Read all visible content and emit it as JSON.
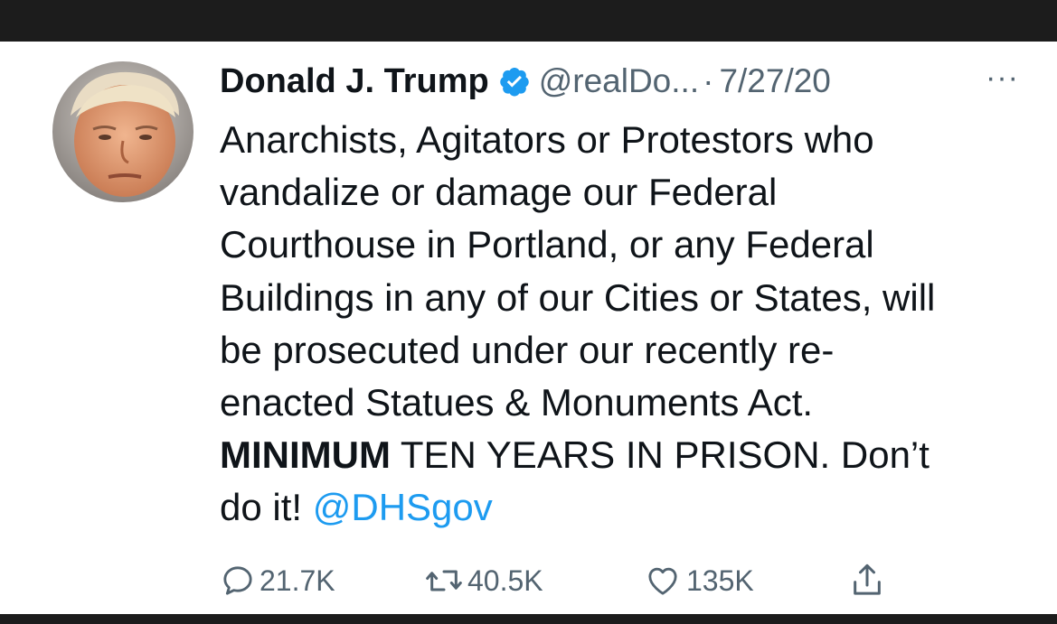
{
  "tweet": {
    "author_name": "Donald J. Trump",
    "handle": "@realDo...",
    "separator": "·",
    "date": "7/27/20",
    "more_label": "···",
    "lines": [
      {
        "normal": "Anarchists, Agitators or Protestors who"
      },
      {
        "normal": "vandalize or damage our Federal"
      },
      {
        "normal": "Courthouse in Portland, or any Federal"
      },
      {
        "normal": "Buildings in any of our Cities or States, will"
      },
      {
        "normal": "be prosecuted under our recently re-"
      },
      {
        "normal": "enacted Statues & Monuments Act."
      },
      {
        "bold": "MINIMUM",
        "normal": " TEN YEARS IN PRISON. Don’t"
      },
      {
        "normal": "do it! ",
        "mention": "@DHSgov"
      }
    ],
    "actions": {
      "reply_count": "21.7K",
      "retweet_count": "40.5K",
      "like_count": "135K"
    }
  },
  "colors": {
    "accent": "#1d9bf0",
    "text": "#0f1419",
    "secondary": "#536471"
  },
  "icons": [
    "verified-badge-icon",
    "more-icon",
    "reply-icon",
    "retweet-icon",
    "like-icon",
    "share-icon"
  ]
}
